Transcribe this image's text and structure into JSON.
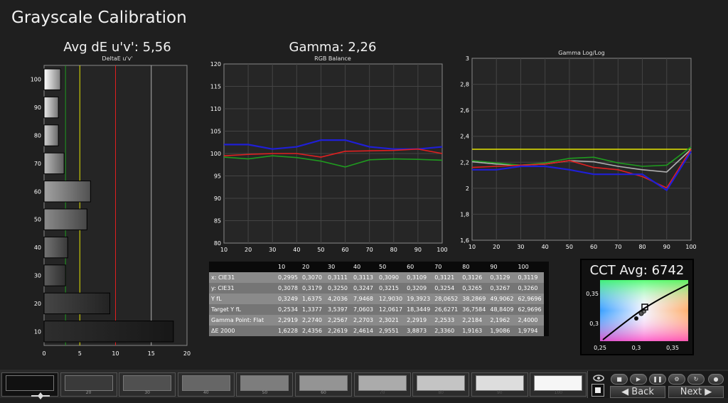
{
  "app": {
    "title": "Grayscale Calibration"
  },
  "colors": {
    "red": "#e02020",
    "green": "#1f9a1f",
    "blue": "#1f1fd6",
    "yellow": "#e6e600",
    "gray": "#b0b0b0"
  },
  "deltae_panel": {
    "heading": "Avg dE u'v': 5,56",
    "chart_title": "DeltaE u'v'"
  },
  "rgb_panel": {
    "heading": "Gamma: 2,26",
    "chart_title": "RGB Balance"
  },
  "gamma_panel": {
    "chart_title": "Gamma Log/Log"
  },
  "cct_panel": {
    "heading": "CCT Avg: 6742",
    "x_ticks": [
      "0,25",
      "0,3",
      "0,35"
    ],
    "y_ticks": [
      "0,35",
      "0,3"
    ]
  },
  "chart_data": [
    {
      "type": "bar",
      "orientation": "horizontal",
      "title": "DeltaE u'v'",
      "categories": [
        "100",
        "90",
        "80",
        "70",
        "60",
        "50",
        "40",
        "30",
        "20",
        "10"
      ],
      "values": [
        2.3,
        2.0,
        2.0,
        2.8,
        6.5,
        6.0,
        3.3,
        3.0,
        9.2,
        18.1
      ],
      "xlim": [
        0,
        20
      ],
      "x_ticks": [
        "0",
        "5",
        "10",
        "15",
        "20"
      ],
      "reference_lines": [
        3,
        5,
        10,
        15
      ],
      "grid": false
    },
    {
      "type": "line",
      "title": "RGB Balance",
      "x": [
        10,
        20,
        30,
        40,
        50,
        60,
        70,
        80,
        90,
        100
      ],
      "ylim": [
        80,
        120
      ],
      "y_ticks": [
        "120",
        "115",
        "110",
        "105",
        "100",
        "95",
        "90",
        "85",
        "80"
      ],
      "x_ticks": [
        "10",
        "20",
        "30",
        "40",
        "50",
        "60",
        "70",
        "80",
        "90",
        "100"
      ],
      "series": [
        {
          "color": "#1f1fd6",
          "values": [
            102,
            102,
            101,
            101.5,
            103,
            103,
            101.5,
            101,
            101,
            101.5
          ]
        },
        {
          "color": "#e02020",
          "values": [
            99.5,
            99.8,
            100,
            100,
            99.2,
            100.5,
            100.6,
            100.7,
            101,
            100
          ]
        },
        {
          "color": "#1f9a1f",
          "values": [
            99.2,
            98.8,
            99.5,
            99.1,
            98.3,
            97,
            98.6,
            98.8,
            98.7,
            98.5
          ]
        }
      ],
      "grid": true
    },
    {
      "type": "line",
      "title": "Gamma Log/Log",
      "x": [
        10,
        20,
        30,
        40,
        50,
        60,
        70,
        80,
        90,
        100
      ],
      "ylim": [
        1.6,
        3.2
      ],
      "y_ticks": [
        "3",
        "2,8",
        "2,6",
        "2,4",
        "2,2",
        "2",
        "1,8",
        "1,6"
      ],
      "x_ticks": [
        "10",
        "20",
        "30",
        "40",
        "50",
        "60",
        "70",
        "80",
        "90",
        "100"
      ],
      "target": 2.4,
      "series": [
        {
          "color": "#e6e600",
          "values": [
            2.4,
            2.4,
            2.4,
            2.4,
            2.4,
            2.4,
            2.4,
            2.4,
            2.4,
            2.4
          ]
        },
        {
          "color": "#b0b0b0",
          "values": [
            2.29,
            2.27,
            2.26,
            2.27,
            2.3,
            2.29,
            2.25,
            2.22,
            2.2,
            2.4
          ]
        },
        {
          "color": "#1f9a1f",
          "values": [
            2.3,
            2.28,
            2.26,
            2.28,
            2.32,
            2.33,
            2.28,
            2.25,
            2.26,
            2.42
          ]
        },
        {
          "color": "#e02020",
          "values": [
            2.24,
            2.25,
            2.26,
            2.27,
            2.3,
            2.24,
            2.22,
            2.16,
            2.06,
            2.4
          ]
        },
        {
          "color": "#1f1fd6",
          "values": [
            2.22,
            2.22,
            2.25,
            2.25,
            2.22,
            2.18,
            2.18,
            2.18,
            2.04,
            2.38
          ]
        }
      ],
      "grid": true
    }
  ],
  "table": {
    "columns": [
      "",
      "10",
      "20",
      "30",
      "40",
      "50",
      "60",
      "70",
      "80",
      "90",
      "100"
    ],
    "rows": [
      [
        "x: CIE31",
        "0,2995",
        "0,3070",
        "0,3111",
        "0,3113",
        "0,3090",
        "0,3109",
        "0,3121",
        "0,3126",
        "0,3129",
        "0,3119"
      ],
      [
        "y: CIE31",
        "0,3078",
        "0,3179",
        "0,3250",
        "0,3247",
        "0,3215",
        "0,3209",
        "0,3254",
        "0,3265",
        "0,3267",
        "0,3260"
      ],
      [
        "Y fL",
        "0,3249",
        "1,6375",
        "4,2036",
        "7,9468",
        "12,9030",
        "19,3923",
        "28,0652",
        "38,2869",
        "49,9062",
        "62,9696"
      ],
      [
        "Target Y fL",
        "0,2534",
        "1,3377",
        "3,5397",
        "7,0603",
        "12,0617",
        "18,3449",
        "26,6271",
        "36,7584",
        "48,8409",
        "62,9696"
      ],
      [
        "Gamma Point: Flat",
        "2,2919",
        "2,2740",
        "2,2567",
        "2,2703",
        "2,3021",
        "2,2919",
        "2,2533",
        "2,2184",
        "2,1962",
        "2,4000"
      ],
      [
        "ΔE 2000",
        "1,6228",
        "2,4356",
        "2,2619",
        "2,4614",
        "2,9551",
        "3,8873",
        "2,3360",
        "1,9163",
        "1,9086",
        "1,9794"
      ]
    ]
  },
  "patches": {
    "items": [
      {
        "label": "",
        "color": "#111111"
      },
      {
        "label": "20",
        "color": "#3a3a3a"
      },
      {
        "label": "30",
        "color": "#505050"
      },
      {
        "label": "40",
        "color": "#666666"
      },
      {
        "label": "50",
        "color": "#7d7d7d"
      },
      {
        "label": "60",
        "color": "#949494"
      },
      {
        "label": "70",
        "color": "#ababab"
      },
      {
        "label": "80",
        "color": "#c4c4c4"
      },
      {
        "label": "90",
        "color": "#dddddd"
      },
      {
        "label": "100",
        "color": "#f6f6f6"
      }
    ]
  },
  "nav": {
    "back_label": "Back",
    "next_label": "Next"
  }
}
